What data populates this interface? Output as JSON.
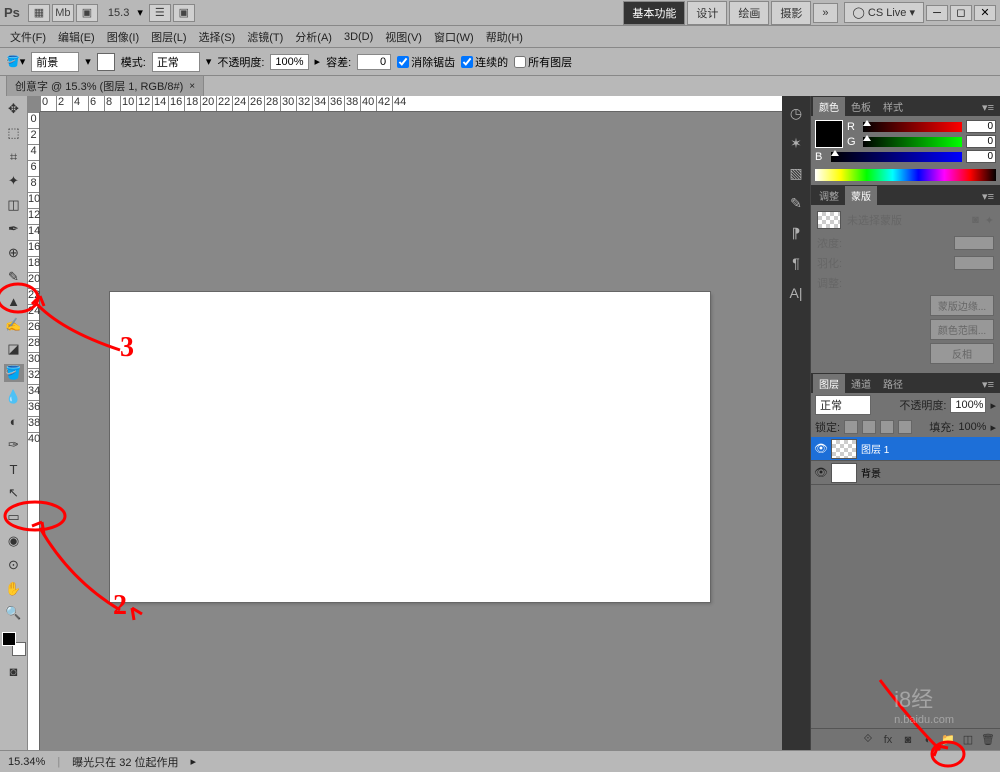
{
  "titlebar": {
    "brand": "Ps",
    "zoom": "15.3",
    "workspace": {
      "basic": "基本功能",
      "design": "设计",
      "draw": "绘画",
      "photo": "摄影"
    },
    "cslive": "CS Live"
  },
  "menu": {
    "file": "文件(F)",
    "edit": "编辑(E)",
    "image": "图像(I)",
    "layer": "图层(L)",
    "select": "选择(S)",
    "filter": "滤镜(T)",
    "analysis": "分析(A)",
    "threed": "3D(D)",
    "view": "视图(V)",
    "window": "窗口(W)",
    "help": "帮助(H)"
  },
  "options": {
    "target": "前景",
    "mode_label": "模式:",
    "mode": "正常",
    "opacity_label": "不透明度:",
    "opacity": "100%",
    "tolerance_label": "容差:",
    "tolerance": "0",
    "antialias": "消除锯齿",
    "contiguous": "连续的",
    "alllayers": "所有图层"
  },
  "doc": {
    "tab": "创意字 @ 15.3% (图层 1, RGB/8#)",
    "close": "×"
  },
  "panels": {
    "color": {
      "tabs": {
        "color": "颜色",
        "swatches": "色板",
        "styles": "样式"
      },
      "r": "R",
      "g": "G",
      "b": "B",
      "rv": "0",
      "gv": "0",
      "bv": "0"
    },
    "mask": {
      "tabs": {
        "adjust": "调整",
        "mask": "蒙版"
      },
      "no_mask": "未选择蒙版",
      "density": "浓度:",
      "feather": "羽化:",
      "adjust_label": "调整:",
      "mask_edge": "蒙版边缘...",
      "color_range": "颜色范围...",
      "invert": "反相"
    },
    "layers": {
      "tabs": {
        "layers": "图层",
        "channels": "通道",
        "paths": "路径"
      },
      "blend": "正常",
      "opacity_label": "不透明度:",
      "opacity": "100%",
      "lock_label": "锁定:",
      "fill_label": "填充:",
      "fill": "100%",
      "layer1": "图层 1",
      "background": "背景"
    }
  },
  "status": {
    "zoom": "15.34%",
    "info": "曝光只在 32 位起作用"
  },
  "annotations": {
    "three": "3",
    "two": "2"
  },
  "watermark": {
    "logo": "i8经",
    "url": "n.baidu.com"
  },
  "ruler_h": [
    "0",
    "2",
    "4",
    "6",
    "8",
    "10",
    "12",
    "14",
    "16",
    "18",
    "20",
    "22",
    "24",
    "26",
    "28",
    "30",
    "32",
    "34",
    "36",
    "38",
    "40",
    "42",
    "44"
  ],
  "ruler_v": [
    "0",
    "2",
    "4",
    "6",
    "8",
    "10",
    "12",
    "14",
    "16",
    "18",
    "20",
    "22",
    "24",
    "26",
    "28",
    "30",
    "32",
    "34",
    "36",
    "38",
    "40"
  ]
}
